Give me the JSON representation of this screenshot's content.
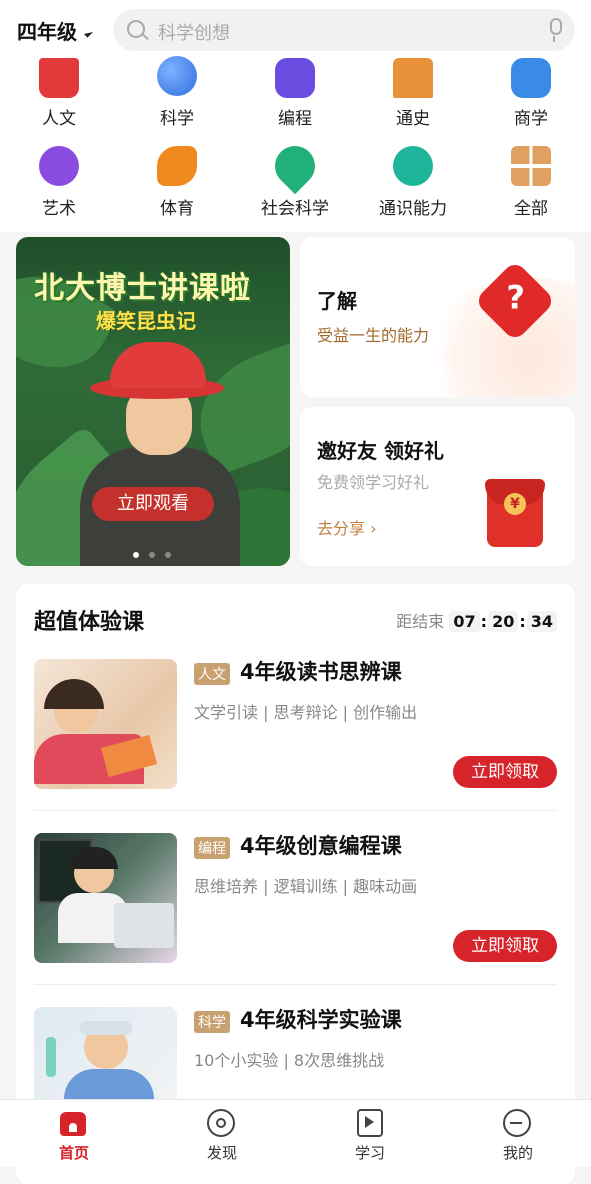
{
  "header": {
    "grade": "四年级",
    "search_placeholder": "科学创想"
  },
  "categories": [
    {
      "label": "人文",
      "icon": "humanities-icon",
      "color": "#e23a3a"
    },
    {
      "label": "科学",
      "icon": "science-planet-icon",
      "color": "#3a7be8"
    },
    {
      "label": "编程",
      "icon": "coding-icon",
      "color": "#6a4ce0"
    },
    {
      "label": "通史",
      "icon": "history-gate-icon",
      "color": "#e8913a"
    },
    {
      "label": "商学",
      "icon": "business-chart-icon",
      "color": "#3a8ae8"
    },
    {
      "label": "艺术",
      "icon": "art-palette-icon",
      "color": "#8a4ce0"
    },
    {
      "label": "体育",
      "icon": "sports-runner-icon",
      "color": "#f08a1e"
    },
    {
      "label": "社会科学",
      "icon": "social-science-pin-icon",
      "color": "#22b07a"
    },
    {
      "label": "通识能力",
      "icon": "general-sprout-icon",
      "color": "#1fb59a"
    },
    {
      "label": "全部",
      "icon": "all-grid-icon",
      "color": "#e0a060"
    }
  ],
  "banner": {
    "title": "北大博士讲课啦",
    "subtitle": "爆笑昆虫记",
    "button": "立即观看",
    "slides": 3,
    "active_slide": 1
  },
  "cards": {
    "learn": {
      "title": "了解",
      "subtitle": "受益一生的能力"
    },
    "invite": {
      "title": "邀好友 领好礼",
      "subtitle": "免费领学习好礼",
      "link": "去分享 ›"
    }
  },
  "deals": {
    "title": "超值体验课",
    "countdown_label": "距结束",
    "hh": "07",
    "mm": "20",
    "ss": "34",
    "courses": [
      {
        "tag": "人文",
        "title": "4年级读书思辨课",
        "desc": "文学引读 | 思考辩论 | 创作输出",
        "button": "立即领取"
      },
      {
        "tag": "编程",
        "title": "4年级创意编程课",
        "desc": "思维培养 | 逻辑训练 | 趣味动画",
        "button": "立即领取"
      },
      {
        "tag": "科学",
        "title": "4年级科学实验课",
        "desc": "10个小实验 | 8次思维挑战",
        "button": ""
      }
    ]
  },
  "tabs": [
    {
      "label": "首页",
      "active": true
    },
    {
      "label": "发现",
      "active": false
    },
    {
      "label": "学习",
      "active": false
    },
    {
      "label": "我的",
      "active": false
    }
  ],
  "colors": {
    "accent": "#d7242a",
    "tag": "#c9a070",
    "muted": "#888888"
  }
}
